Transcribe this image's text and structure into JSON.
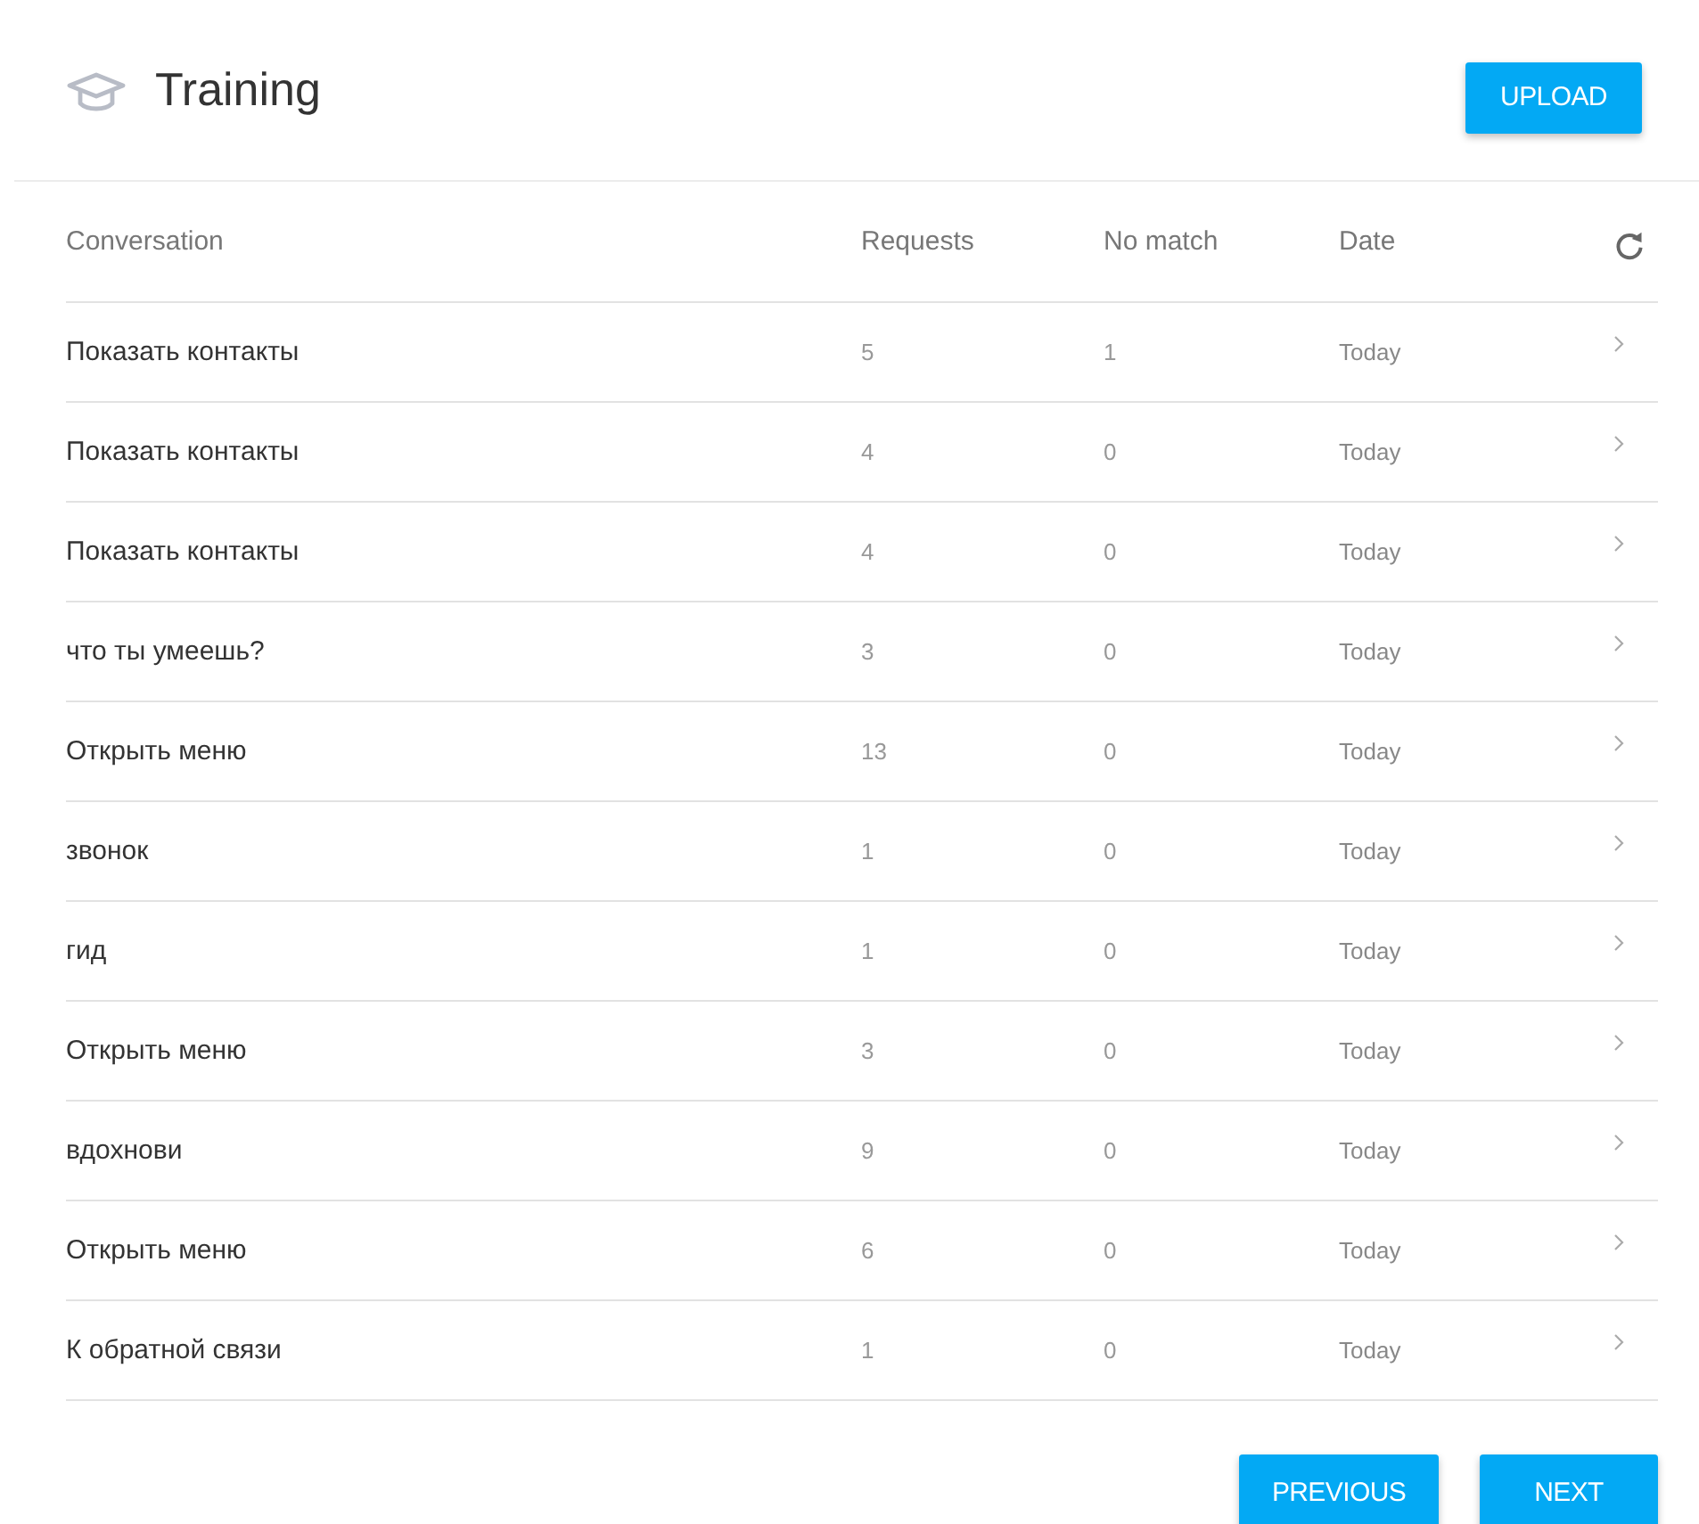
{
  "header": {
    "title": "Training",
    "upload_button": "UPLOAD"
  },
  "table": {
    "columns": [
      "Conversation",
      "Requests",
      "No match",
      "Date"
    ],
    "rows": [
      {
        "conversation": "Показать контакты",
        "requests": "5",
        "no_match": "1",
        "date": "Today"
      },
      {
        "conversation": "Показать контакты",
        "requests": "4",
        "no_match": "0",
        "date": "Today"
      },
      {
        "conversation": "Показать контакты",
        "requests": "4",
        "no_match": "0",
        "date": "Today"
      },
      {
        "conversation": "что ты умеешь?",
        "requests": "3",
        "no_match": "0",
        "date": "Today"
      },
      {
        "conversation": "Открыть меню",
        "requests": "13",
        "no_match": "0",
        "date": "Today"
      },
      {
        "conversation": "звонок",
        "requests": "1",
        "no_match": "0",
        "date": "Today"
      },
      {
        "conversation": "гид",
        "requests": "1",
        "no_match": "0",
        "date": "Today"
      },
      {
        "conversation": "Открыть меню",
        "requests": "3",
        "no_match": "0",
        "date": "Today"
      },
      {
        "conversation": "вдохнови",
        "requests": "9",
        "no_match": "0",
        "date": "Today"
      },
      {
        "conversation": "Открыть меню",
        "requests": "6",
        "no_match": "0",
        "date": "Today"
      },
      {
        "conversation": "К обратной связи",
        "requests": "1",
        "no_match": "0",
        "date": "Today"
      }
    ]
  },
  "pagination": [
    "PREVIOUS",
    "NEXT"
  ]
}
